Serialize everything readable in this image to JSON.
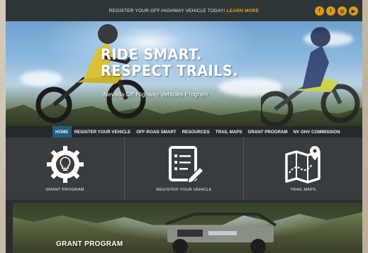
{
  "topbar": {
    "message": "REGISTER YOUR OFF-HIGHWAY VEHICLE TODAY!",
    "cta": "LEARN MORE"
  },
  "social": [
    {
      "icon": "facebook-icon",
      "glyph": "f"
    },
    {
      "icon": "twitter-icon",
      "glyph": "t"
    },
    {
      "icon": "instagram-icon",
      "glyph": "◎"
    },
    {
      "icon": "youtube-icon",
      "glyph": "▶"
    }
  ],
  "hero": {
    "line1": "RIDE SMART.",
    "line2": "RESPECT TRAILS.",
    "subtitle": "Nevada Off-Highway Vehicles Program"
  },
  "nav": {
    "items": [
      "HOME",
      "REGISTER YOUR VEHICLE",
      "OFF-ROAD SMART",
      "RESOURCES",
      "TRAIL MAPS",
      "GRANT PROGRAM",
      "NV OHV COMMISSION"
    ],
    "active": "HOME"
  },
  "tiles": [
    {
      "label": "GRANT PROGRAM",
      "icon": "gear-lightbulb-icon"
    },
    {
      "label": "REGISTER YOUR VEHICLE",
      "icon": "form-pencil-icon"
    },
    {
      "label": "TRAIL MAPS",
      "icon": "map-pin-icon"
    }
  ],
  "banner": {
    "title": "GRANT PROGRAM"
  },
  "colors": {
    "accent": "#e0a41c",
    "nav_active": "#1d5f7f",
    "topbar": "#2e3539"
  }
}
